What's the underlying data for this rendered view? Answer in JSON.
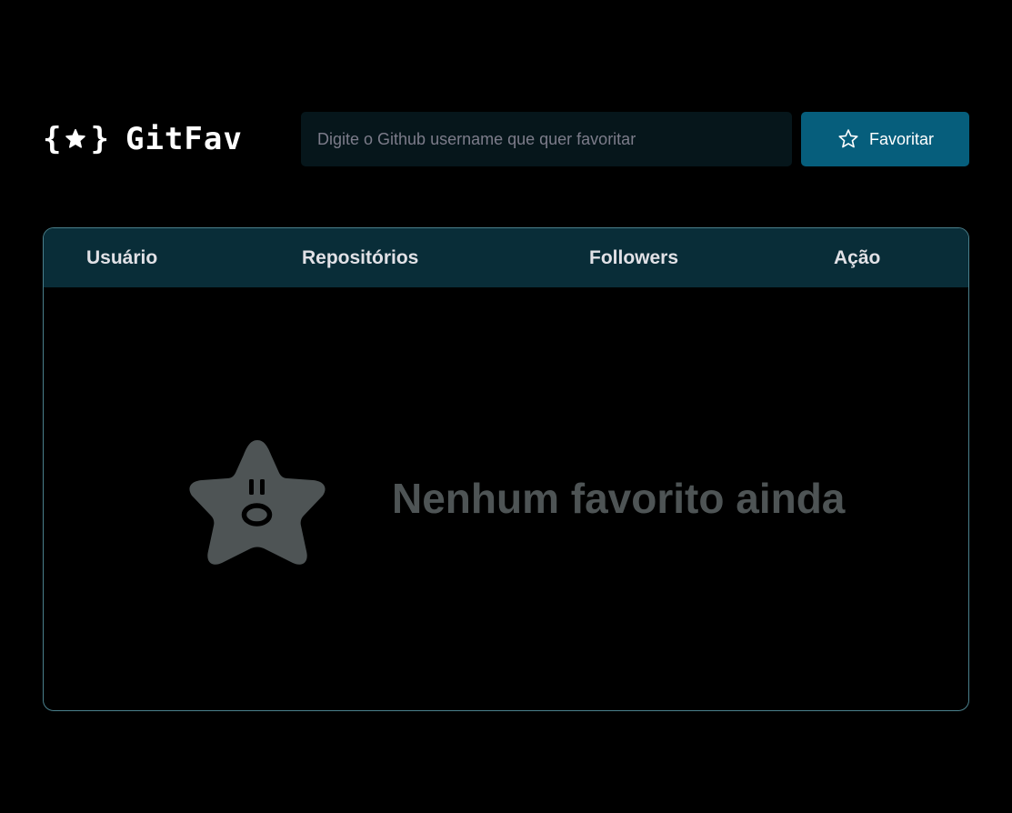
{
  "header": {
    "logo": {
      "text": "GitFav",
      "icon": "star-braces-icon"
    },
    "search": {
      "placeholder": "Digite o Github username que quer favoritar",
      "value": ""
    },
    "favorite_button": {
      "label": "Favoritar",
      "icon": "star-outline-icon"
    }
  },
  "table": {
    "columns": [
      "Usuário",
      "Repositórios",
      "Followers",
      "Ação"
    ],
    "rows": [],
    "empty_state": {
      "icon": "surprised-star-icon",
      "message": "Nenhum favorito ainda"
    }
  },
  "colors": {
    "background": "#000000",
    "accent": "#065e7c",
    "table_header": "#092d38",
    "input_background": "#06161b",
    "border": "#4a808c",
    "empty_text": "#4e5455"
  }
}
